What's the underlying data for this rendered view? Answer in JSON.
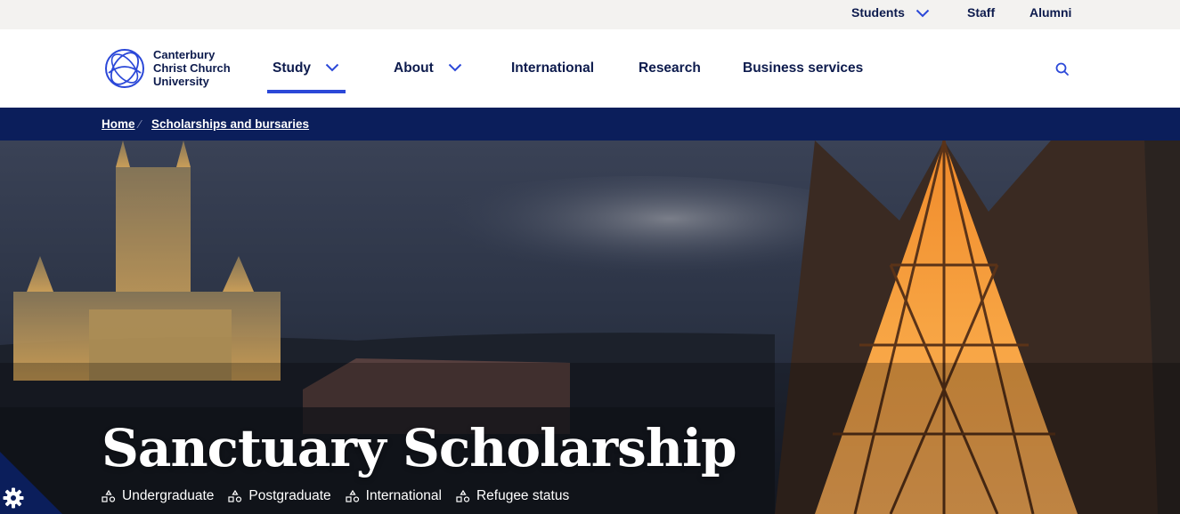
{
  "utility": {
    "students": "Students",
    "staff": "Staff",
    "alumni": "Alumni"
  },
  "logo": {
    "line1": "Canterbury",
    "line2": "Christ Church",
    "line3": "University"
  },
  "nav": {
    "study": "Study",
    "about": "About",
    "international": "International",
    "research": "Research",
    "business": "Business services"
  },
  "breadcrumb": {
    "home": "Home",
    "current": "Scholarships and bursaries",
    "separator": "⁄"
  },
  "hero": {
    "title": "Sanctuary Scholarship",
    "tags": [
      "Undergraduate",
      "Postgraduate",
      "International",
      "Refugee status"
    ]
  },
  "colors": {
    "navy": "#0b1e5b",
    "text": "#0d1b4d",
    "accent": "#2b48d8",
    "utility_bg": "#f3f2f0"
  },
  "icons": {
    "students_chevron": "chevron-down-icon",
    "search": "search-icon",
    "tag": "level-icon",
    "cookie": "gear-icon"
  }
}
